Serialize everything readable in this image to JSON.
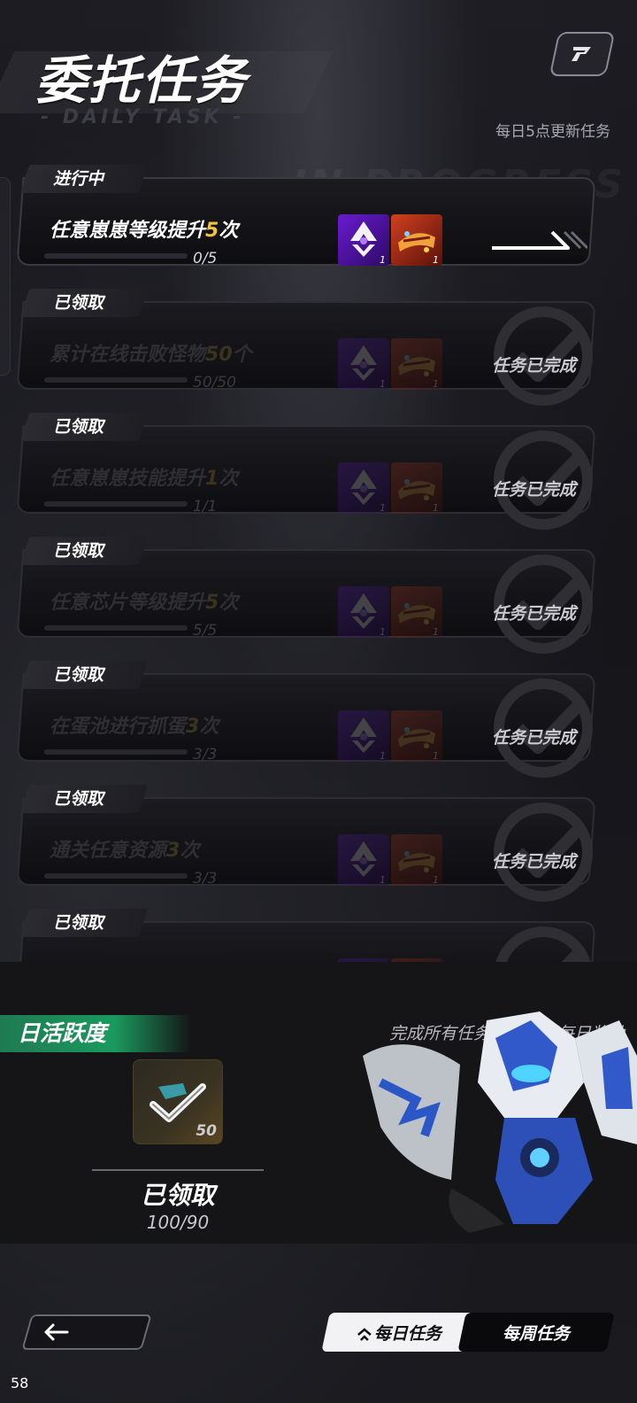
{
  "header": {
    "title": "委托任务",
    "subtitle": "- DAILY TASK -",
    "refresh_note": "每日5点更新任务",
    "help_icon": "help-icon"
  },
  "list_bg_word": "IN PROGRESS",
  "tasks": [
    {
      "status": "进行中",
      "name_pre": "任意崽崽等级提升",
      "name_hl": "5",
      "name_post": "次",
      "progress": "0/5",
      "progress_fraction": 0.0,
      "rewards": [
        {
          "icon": "badge-icon",
          "qty": "1"
        },
        {
          "icon": "crown-icon",
          "qty": "1"
        }
      ],
      "done": false
    },
    {
      "status": "已领取",
      "name_pre": "累计在线击败怪物",
      "name_hl": "50",
      "name_post": "个",
      "progress": "50/50",
      "progress_fraction": 1.0,
      "rewards": [
        {
          "icon": "badge-icon",
          "qty": "1"
        },
        {
          "icon": "crown-icon",
          "qty": "1"
        }
      ],
      "done": true,
      "done_text": "任务已完成"
    },
    {
      "status": "已领取",
      "name_pre": "任意崽崽技能提升",
      "name_hl": "1",
      "name_post": "次",
      "progress": "1/1",
      "progress_fraction": 1.0,
      "rewards": [
        {
          "icon": "badge-icon",
          "qty": "1"
        },
        {
          "icon": "crown-icon",
          "qty": "1"
        }
      ],
      "done": true,
      "done_text": "任务已完成"
    },
    {
      "status": "已领取",
      "name_pre": "任意芯片等级提升",
      "name_hl": "5",
      "name_post": "次",
      "progress": "5/5",
      "progress_fraction": 1.0,
      "rewards": [
        {
          "icon": "badge-icon",
          "qty": "1"
        },
        {
          "icon": "crown-icon",
          "qty": "1"
        }
      ],
      "done": true,
      "done_text": "任务已完成"
    },
    {
      "status": "已领取",
      "name_pre": "在蛋池进行抓蛋",
      "name_hl": "3",
      "name_post": "次",
      "progress": "3/3",
      "progress_fraction": 1.0,
      "rewards": [
        {
          "icon": "badge-icon",
          "qty": "1"
        },
        {
          "icon": "crown-icon",
          "qty": "1"
        }
      ],
      "done": true,
      "done_text": "任务已完成"
    },
    {
      "status": "已领取",
      "name_pre": "通关任意资源",
      "name_hl": "3",
      "name_post": "次",
      "progress": "3/3",
      "progress_fraction": 1.0,
      "rewards": [
        {
          "icon": "badge-icon",
          "qty": "1"
        },
        {
          "icon": "crown-icon",
          "qty": "1"
        }
      ],
      "done": true,
      "done_text": "任务已完成"
    },
    {
      "status": "已领取",
      "name_pre": "",
      "name_hl": "",
      "name_post": "",
      "progress": "",
      "progress_fraction": 1.0,
      "rewards": [
        {
          "icon": "badge-icon",
          "qty": ""
        },
        {
          "icon": "crown-icon",
          "qty": ""
        }
      ],
      "done": true,
      "done_text": ""
    }
  ],
  "activity": {
    "label": "日活跃度",
    "note": "完成所有任务即可解锁每日奖励",
    "chest_value": "50",
    "claimed_label": "已领取",
    "score": "100/90"
  },
  "nav": {
    "back_icon": "back-arrow-icon",
    "tab_daily": "每日任务",
    "tab_weekly": "每周任务"
  },
  "fps": "58"
}
